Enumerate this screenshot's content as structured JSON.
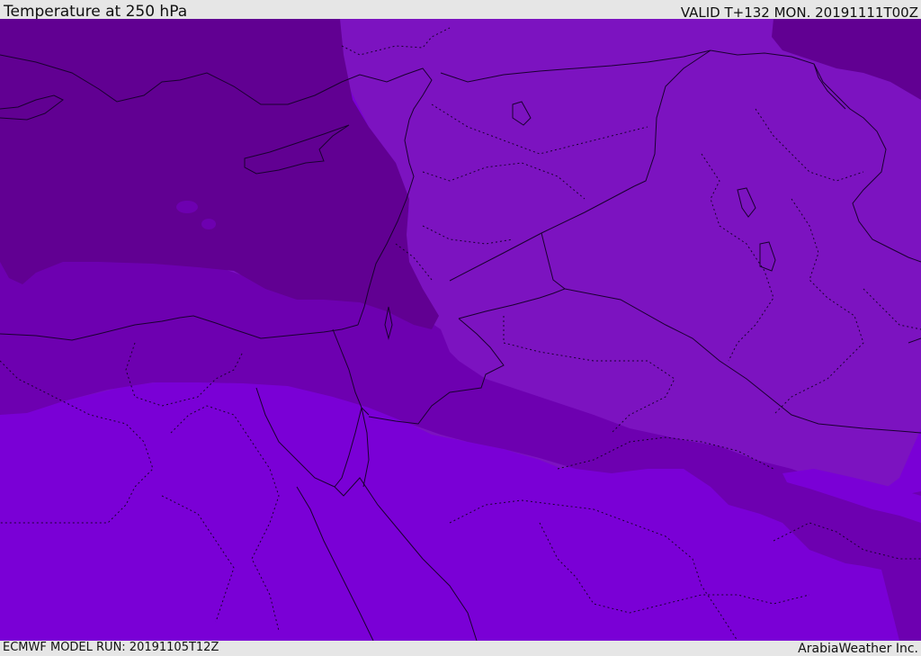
{
  "header": {
    "title": "Temperature at 250 hPa",
    "valid": "VALID T+132 MON. 20191111T00Z"
  },
  "footer": {
    "model_run": "ECMWF MODEL RUN: 20191105T12Z",
    "credit": "ArabiaWeather Inc."
  },
  "map": {
    "field": "temperature",
    "pressure_level": "250 hPa",
    "bands": [
      {
        "name": "coldest",
        "color": "#610092"
      },
      {
        "name": "cold",
        "color": "#6d00b0"
      },
      {
        "name": "mid",
        "color": "#7c13c0"
      },
      {
        "name": "warm",
        "color": "#7a00d6"
      }
    ],
    "line_colors": {
      "coastline": "#1a0030",
      "border": "#1a0030"
    }
  }
}
